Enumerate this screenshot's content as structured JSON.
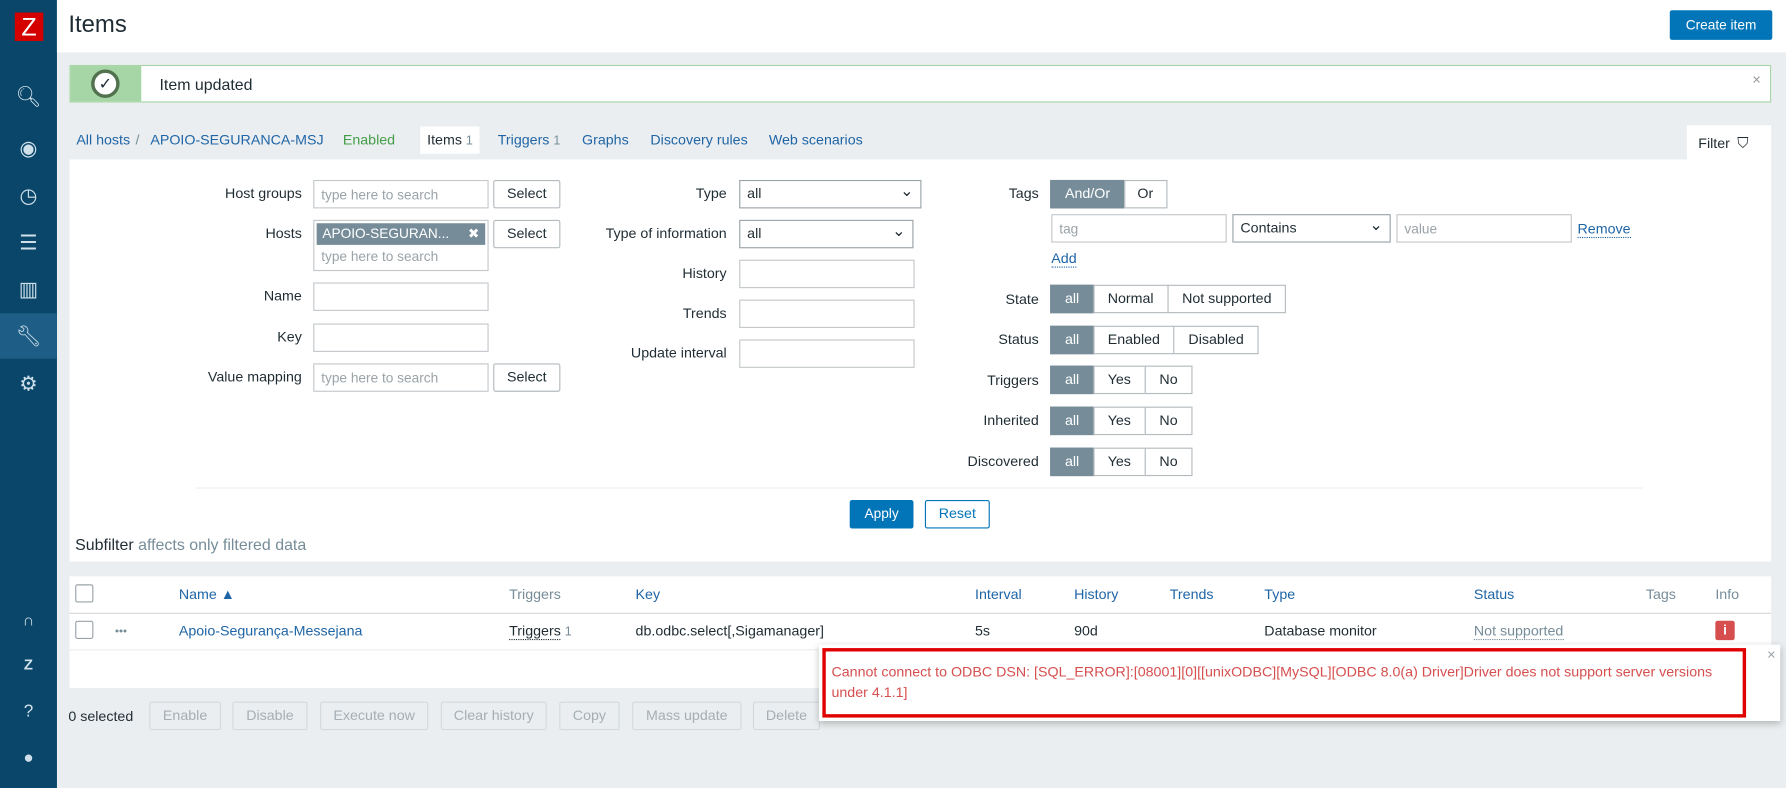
{
  "header": {
    "title": "Items",
    "create_button": "Create item"
  },
  "sidebar": {
    "logo": "Z",
    "items": [
      "search-icon",
      "eye-icon",
      "timer-icon",
      "list-icon",
      "chart-icon",
      "wrench-icon",
      "gear-icon"
    ],
    "bottom": [
      "headset-icon",
      "zabbix-share-icon",
      "help-icon",
      "user-icon"
    ]
  },
  "message": {
    "text": "Item updated",
    "close": "×"
  },
  "breadcrumb": {
    "all_hosts": "All hosts",
    "separator": "/",
    "host": "APOIO-SEGURANCA-MSJ",
    "status": "Enabled",
    "tabs": [
      {
        "label": "Items",
        "count": "1"
      },
      {
        "label": "Triggers",
        "count": "1"
      },
      {
        "label": "Graphs"
      },
      {
        "label": "Discovery rules"
      },
      {
        "label": "Web scenarios"
      }
    ]
  },
  "filter": {
    "tab_label": "Filter",
    "host_groups": {
      "label": "Host groups",
      "placeholder": "type here to search",
      "button": "Select"
    },
    "hosts": {
      "label": "Hosts",
      "chip": "APOIO-SEGURAN...",
      "placeholder": "type here to search",
      "button": "Select"
    },
    "name": {
      "label": "Name",
      "value": ""
    },
    "key": {
      "label": "Key",
      "value": ""
    },
    "value_mapping": {
      "label": "Value mapping",
      "placeholder": "type here to search",
      "button": "Select"
    },
    "type": {
      "label": "Type",
      "value": "all"
    },
    "type_of_information": {
      "label": "Type of information",
      "value": "all"
    },
    "history": {
      "label": "History",
      "value": ""
    },
    "trends": {
      "label": "Trends",
      "value": ""
    },
    "update_interval": {
      "label": "Update interval",
      "value": ""
    },
    "tags": {
      "label": "Tags",
      "options": [
        "And/Or",
        "Or"
      ],
      "tag_placeholder": "tag",
      "operator": "Contains",
      "value_placeholder": "value",
      "remove": "Remove",
      "add": "Add"
    },
    "state": {
      "label": "State",
      "options": [
        "all",
        "Normal",
        "Not supported"
      ]
    },
    "status": {
      "label": "Status",
      "options": [
        "all",
        "Enabled",
        "Disabled"
      ]
    },
    "triggers": {
      "label": "Triggers",
      "options": [
        "all",
        "Yes",
        "No"
      ]
    },
    "inherited": {
      "label": "Inherited",
      "options": [
        "all",
        "Yes",
        "No"
      ]
    },
    "discovered": {
      "label": "Discovered",
      "options": [
        "all",
        "Yes",
        "No"
      ]
    },
    "apply": "Apply",
    "reset": "Reset"
  },
  "subfilter": {
    "title": "Subfilter",
    "note": "affects only filtered data"
  },
  "table": {
    "columns": [
      "Name ▲",
      "Triggers",
      "Key",
      "Interval",
      "History",
      "Trends",
      "Type",
      "Status",
      "Tags",
      "Info"
    ],
    "rows": [
      {
        "menu": "•••",
        "name": "Apoio-Segurança-Messejana",
        "triggers": "Triggers",
        "triggers_count": "1",
        "key": "db.odbc.select[,Sigamanager]",
        "interval": "5s",
        "history": "90d",
        "trends": "",
        "type": "Database monitor",
        "status": "Not supported",
        "info": "i"
      }
    ]
  },
  "actions": {
    "selected": "0 selected",
    "buttons": [
      "Enable",
      "Disable",
      "Execute now",
      "Clear history",
      "Copy",
      "Mass update",
      "Delete"
    ]
  },
  "error_popup": {
    "text": "Cannot connect to ODBC DSN: [SQL_ERROR]:[08001][0][[unixODBC][MySQL][ODBC 8.0(a) Driver]Driver does not support server versions under 4.1.1]",
    "close": "×"
  },
  "colors": {
    "sidebar": "#0a466a",
    "primary": "#0275b8",
    "error": "#d64e4e",
    "success": "#a6d6a6"
  }
}
